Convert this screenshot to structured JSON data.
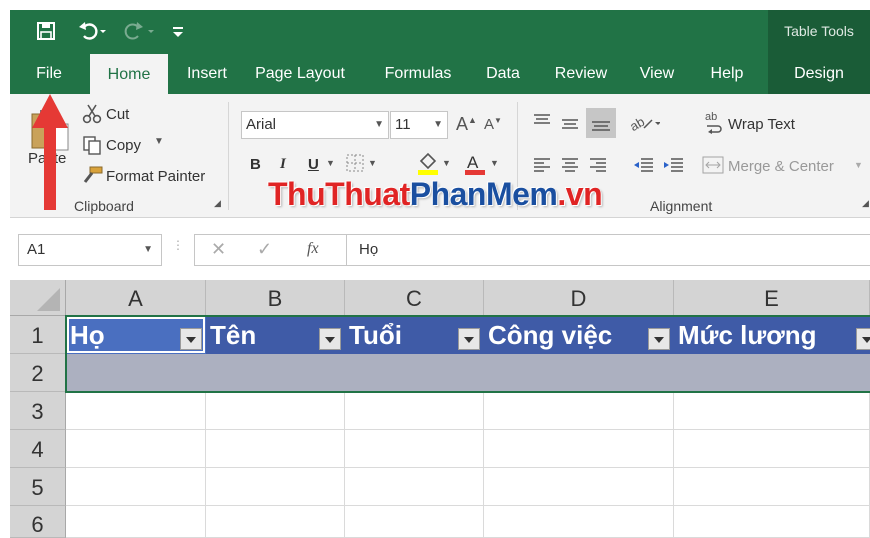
{
  "titlebar": {
    "table_tools": "Table Tools"
  },
  "tabs": [
    "File",
    "Home",
    "Insert",
    "Page Layout",
    "Formulas",
    "Data",
    "Review",
    "View",
    "Help",
    "Design"
  ],
  "clipboard": {
    "cut": "Cut",
    "copy": "Copy",
    "format_painter": "Format Painter",
    "paste": "Paste",
    "group_label": "Clipboard"
  },
  "font": {
    "name": "Arial",
    "size": "11",
    "bold": "B",
    "italic": "I",
    "underline": "U"
  },
  "alignment": {
    "wrap_text": "Wrap Text",
    "merge_center": "Merge & Center",
    "group_label": "Alignment"
  },
  "watermark": {
    "part1": "ThuThuat",
    "part2": "PhanMem",
    "part3": ".vn"
  },
  "formula_bar": {
    "name_box": "A1",
    "fx": "fx",
    "content": "Họ"
  },
  "grid": {
    "columns": [
      "A",
      "B",
      "C",
      "D",
      "E"
    ],
    "rows": [
      "1",
      "2",
      "3",
      "4",
      "5",
      "6"
    ],
    "headers": [
      "Họ",
      "Tên",
      "Tuổi",
      "Công việc",
      "Mức lương"
    ]
  },
  "colors": {
    "excel_green": "#217346",
    "table_header_blue": "#3f5ba7",
    "table_row_gray": "#acb0c0",
    "arrow_red": "#e53935"
  }
}
